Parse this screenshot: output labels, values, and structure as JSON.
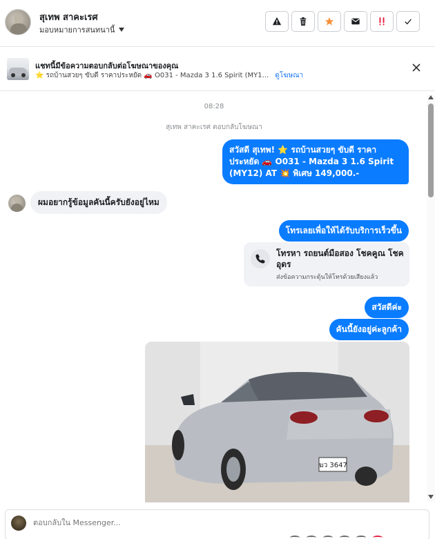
{
  "header": {
    "contact_name": "สุเทพ สาคะเรศ",
    "assign_label": "มอบหมายการสนทนานี้",
    "actions": [
      {
        "icon": "warning-icon",
        "color": "#1c1e21"
      },
      {
        "icon": "trash-icon",
        "color": "#1c1e21"
      },
      {
        "icon": "star-icon",
        "color": "#f7923b"
      },
      {
        "icon": "mail-icon",
        "color": "#1c1e21"
      },
      {
        "icon": "important-icon",
        "color": "#e41e3f"
      },
      {
        "icon": "check-icon",
        "color": "#1c1e21"
      }
    ]
  },
  "ad_banner": {
    "title": "แชทนี้มีข้อความตอบกลับต่อโฆษณาของคุณ",
    "subtitle": "⭐ รถบ้านสวยๆ ขับดี ราคาประหยัด 🚗 O031 - Mazda 3 1.6 Spirit (MY1...",
    "link": "ดูโฆษณา"
  },
  "chat": {
    "timestamp": "08:28",
    "system_note": "สุเทพ สาคะเรศ ตอบกลับโฆษณา",
    "messages": [
      {
        "from": "page",
        "text": "สวัสดี สุเทพ! ⭐ รถบ้านสวยๆ ขับดี ราคาประหยัด 🚗 O031 - Mazda 3 1.6 Spirit (MY12) AT 💥 พิเศษ 149,000.-"
      },
      {
        "from": "user",
        "text": "ผมอยากรู้ข้อมูลคันนี้ครับยังอยู่ไหม"
      },
      {
        "from": "page",
        "text": "โทรเลยเพื่อให้ได้รับบริการเร็วขึ้น"
      },
      {
        "from": "page",
        "type": "call_card",
        "title": "โทรหา รถยนต์มือสอง โชคคูณ โชค อุดร",
        "subtitle": "ส่งข้อความกระตุ้นให้โทรด้วยเสียงแล้ว"
      },
      {
        "from": "page",
        "text": "สวัสดีค่ะ"
      },
      {
        "from": "page",
        "text": "คันนี้ยังอยู่ค่ะลูกค้า"
      },
      {
        "from": "page",
        "type": "image",
        "plate": "ฆว 3647"
      }
    ]
  },
  "composer": {
    "placeholder": "ตอบกลับใน Messenger..."
  },
  "colors": {
    "outgoing_bubble": "#0a7cff",
    "incoming_bubble": "#f0f2f5",
    "link": "#1877f2"
  }
}
